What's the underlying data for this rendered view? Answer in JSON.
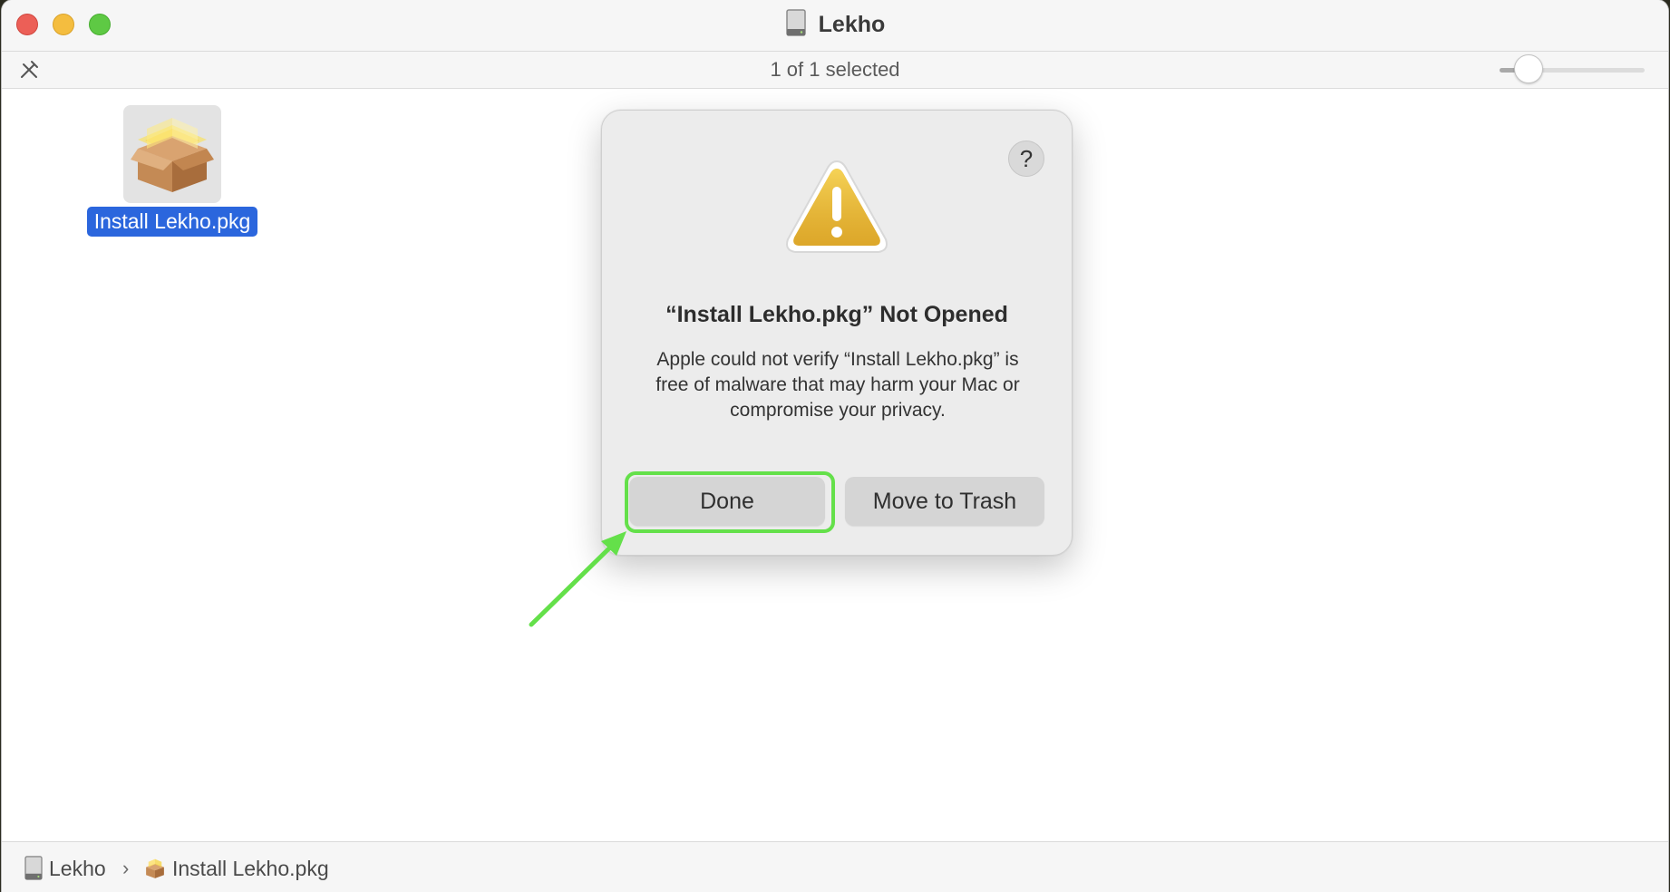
{
  "window": {
    "title": "Lekho",
    "title_icon": "external-disk-icon"
  },
  "toolbar": {
    "tools_icon": "tools-icon",
    "status": "1 of 1 selected",
    "icon_size_slider": 0.2
  },
  "files": [
    {
      "name": "Install Lekho.pkg",
      "icon": "package-icon",
      "selected": true
    }
  ],
  "dialog": {
    "title": "“Install Lekho.pkg” Not Opened",
    "message": "Apple could not verify “Install Lekho.pkg” is free of malware that may harm your Mac or compromise your privacy.",
    "help_label": "?",
    "icon": "warning-icon",
    "buttons": {
      "done": "Done",
      "trash": "Move to Trash"
    }
  },
  "annotation": {
    "highlight_color": "#64e04a",
    "target": "Done"
  },
  "pathbar": {
    "items": [
      {
        "label": "Lekho",
        "icon": "external-disk-icon"
      },
      {
        "label": "Install Lekho.pkg",
        "icon": "package-icon"
      }
    ],
    "separator": "›"
  },
  "colors": {
    "selection": "#2b66dd",
    "close": "#ec5f57",
    "minimize": "#f4bd3f",
    "zoom": "#5ec944",
    "warning": "#e8b63a"
  }
}
